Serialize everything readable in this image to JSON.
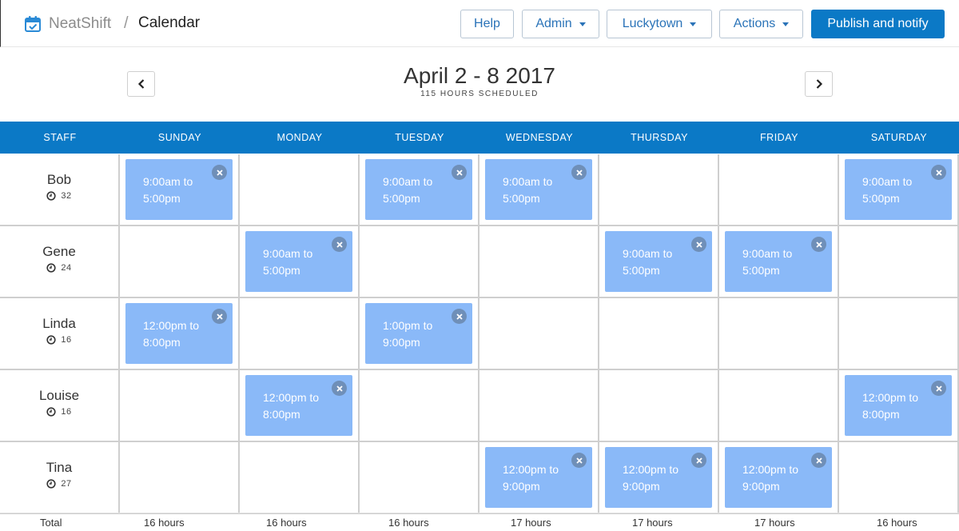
{
  "app": {
    "name": "NeatShift",
    "separator": "/",
    "page": "Calendar"
  },
  "toolbar": {
    "help": "Help",
    "admin": "Admin",
    "location": "Luckytown",
    "actions": "Actions",
    "publish": "Publish and notify"
  },
  "week": {
    "title": "April 2 - 8 2017",
    "subtitle": "115 HOURS SCHEDULED"
  },
  "colors": {
    "accent": "#0b79c6",
    "shift": "#8ab9f8"
  },
  "columns": [
    "STAFF",
    "SUNDAY",
    "MONDAY",
    "TUESDAY",
    "WEDNESDAY",
    "THURSDAY",
    "FRIDAY",
    "SATURDAY"
  ],
  "staff": [
    {
      "name": "Bob",
      "hours": "32",
      "shifts": [
        {
          "start": "9:00am to",
          "end": "5:00pm"
        },
        null,
        {
          "start": "9:00am to",
          "end": "5:00pm"
        },
        {
          "start": "9:00am to",
          "end": "5:00pm"
        },
        null,
        null,
        {
          "start": "9:00am to",
          "end": "5:00pm"
        }
      ]
    },
    {
      "name": "Gene",
      "hours": "24",
      "shifts": [
        null,
        {
          "start": "9:00am to",
          "end": "5:00pm"
        },
        null,
        null,
        {
          "start": "9:00am to",
          "end": "5:00pm"
        },
        {
          "start": "9:00am to",
          "end": "5:00pm"
        },
        null
      ]
    },
    {
      "name": "Linda",
      "hours": "16",
      "shifts": [
        {
          "start": "12:00pm to",
          "end": "8:00pm"
        },
        null,
        {
          "start": "1:00pm to",
          "end": "9:00pm"
        },
        null,
        null,
        null,
        null
      ]
    },
    {
      "name": "Louise",
      "hours": "16",
      "shifts": [
        null,
        {
          "start": "12:00pm to",
          "end": "8:00pm"
        },
        null,
        null,
        null,
        null,
        {
          "start": "12:00pm to",
          "end": "8:00pm"
        }
      ]
    },
    {
      "name": "Tina",
      "hours": "27",
      "shifts": [
        null,
        null,
        null,
        {
          "start": "12:00pm to",
          "end": "9:00pm"
        },
        {
          "start": "12:00pm to",
          "end": "9:00pm"
        },
        {
          "start": "12:00pm to",
          "end": "9:00pm"
        },
        null
      ]
    }
  ],
  "totals": {
    "label": "Total",
    "values": [
      "16 hours",
      "16 hours",
      "16 hours",
      "17 hours",
      "17 hours",
      "17 hours",
      "16 hours"
    ]
  }
}
